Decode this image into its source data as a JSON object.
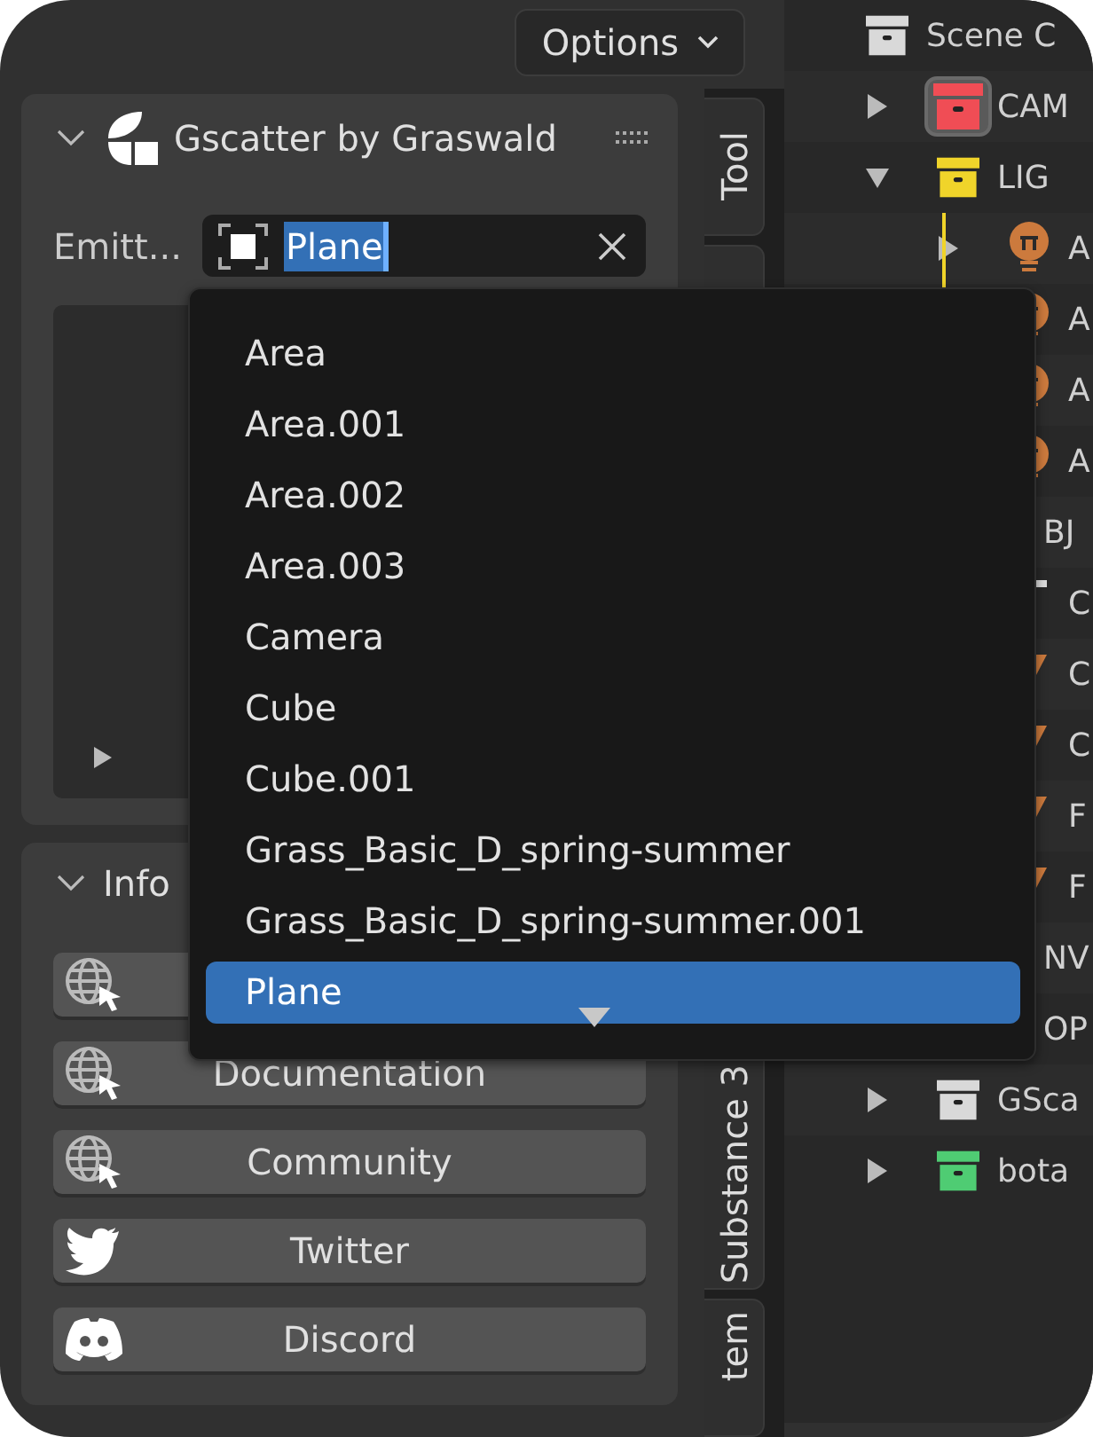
{
  "header": {
    "options_label": "Options"
  },
  "panel": {
    "title": "Gscatter by Graswald",
    "expanded": true,
    "emitter_label": "Emitt...",
    "emitter_value": "Plane"
  },
  "info": {
    "title": "Info",
    "expanded": true,
    "buttons": [
      {
        "kind": "globe"
      },
      {
        "kind": "globe",
        "label": "Documentation"
      },
      {
        "kind": "globe",
        "label": "Community"
      },
      {
        "kind": "twitter",
        "label": "Twitter"
      },
      {
        "kind": "discord",
        "label": "Discord"
      }
    ]
  },
  "sidebar_tabs": [
    {
      "label": "Tool"
    },
    {
      "label": "Substance 3"
    },
    {
      "label": "tem"
    }
  ],
  "dropdown": {
    "items": [
      {
        "label": "Area",
        "selected": false
      },
      {
        "label": "Area.001",
        "selected": false
      },
      {
        "label": "Area.002",
        "selected": false
      },
      {
        "label": "Area.003",
        "selected": false
      },
      {
        "label": "Camera",
        "selected": false
      },
      {
        "label": "Cube",
        "selected": false
      },
      {
        "label": "Cube.001",
        "selected": false
      },
      {
        "label": "Grass_Basic_D_spring-summer",
        "selected": false
      },
      {
        "label": "Grass_Basic_D_spring-summer.001",
        "selected": false
      },
      {
        "label": "Plane",
        "selected": true
      }
    ]
  },
  "outliner": {
    "items": [
      {
        "label": "Scene C",
        "kind": "collection",
        "color": "#d9d9d9",
        "selected": false,
        "children": [
          {
            "label": "CAM",
            "kind": "collection",
            "color": "#f04d55",
            "selected": true,
            "expanded": false
          },
          {
            "label": "LIG",
            "kind": "collection",
            "color": "#f0d42a",
            "selected": false,
            "expanded": true,
            "children": [
              {
                "label": "A",
                "kind": "light",
                "selected": false,
                "expanded": false
              },
              {
                "label": "A",
                "kind": "light",
                "selected": false
              },
              {
                "label": "A",
                "kind": "light",
                "selected": false
              },
              {
                "label": "A",
                "kind": "light",
                "selected": false
              }
            ]
          },
          {
            "label": "BJ",
            "covered": true,
            "selected": false,
            "children": [
              {
                "label": "C",
                "kind": "empty",
                "selected": false
              },
              {
                "label": "C",
                "kind": "cone",
                "selected": false
              },
              {
                "label": "C",
                "kind": "cone",
                "selected": false
              },
              {
                "label": "F",
                "kind": "cone",
                "selected": false
              },
              {
                "label": "F",
                "kind": "cone",
                "selected": false
              }
            ]
          },
          {
            "label": "NV",
            "covered": true,
            "selected": false
          },
          {
            "label": "OP",
            "covered": true,
            "selected": false
          },
          {
            "label": "GSca",
            "kind": "collection",
            "color": "#d9d9d9",
            "selected": false,
            "expanded": false
          },
          {
            "label": "bota",
            "kind": "collection",
            "color": "#4fcc73",
            "selected": false,
            "expanded": false
          }
        ]
      }
    ]
  }
}
